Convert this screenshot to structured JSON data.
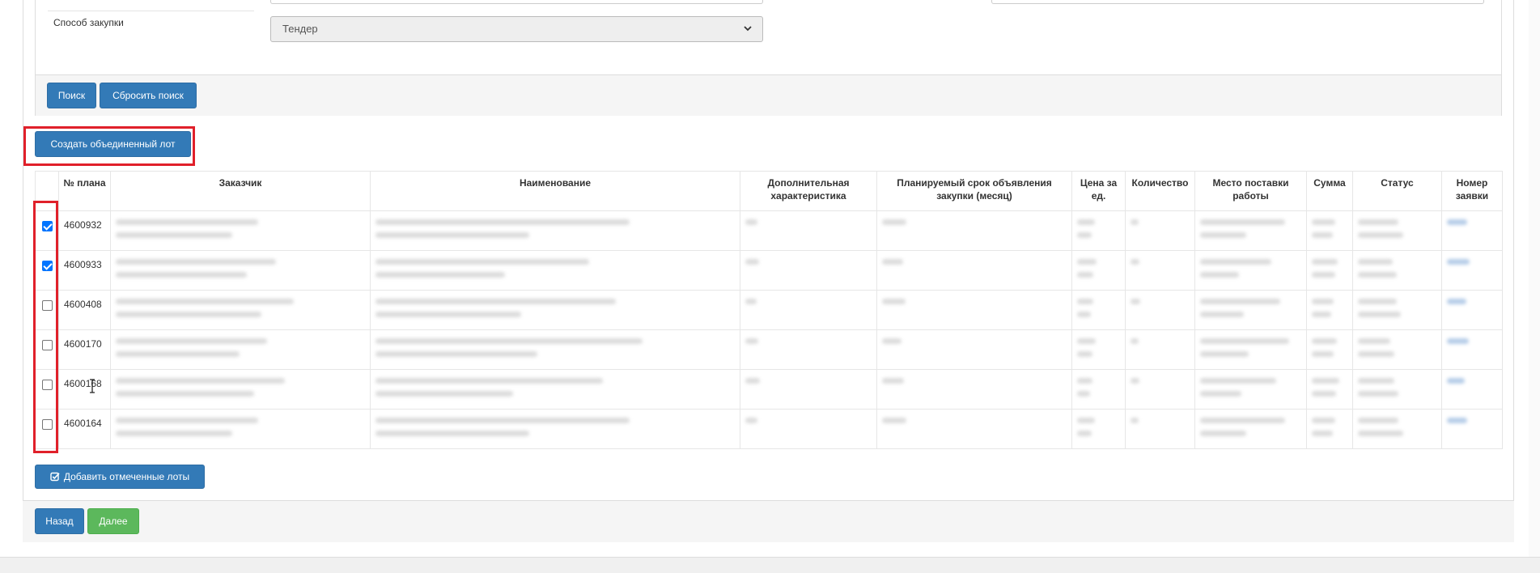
{
  "search": {
    "procurement_method_label": "Способ закупки",
    "procurement_method_value": "Тендер",
    "search_button": "Поиск",
    "reset_button": "Сбросить поиск"
  },
  "actions": {
    "create_merged_lot": "Создать объединенный лот",
    "add_checked_lots": "Добавить отмеченные лоты",
    "back": "Назад",
    "next": "Далее"
  },
  "table": {
    "columns": [
      "№ плана",
      "Заказчик",
      "Наименование",
      "Дополнительная характеристика",
      "Планируемый срок объявления закупки (месяц)",
      "Цена за ед.",
      "Количество",
      "Место поставки работы",
      "Сумма",
      "Статус",
      "Номер заявки"
    ],
    "rows": [
      {
        "plan": "4600932",
        "checked": true
      },
      {
        "plan": "4600933",
        "checked": true
      },
      {
        "plan": "4600408",
        "checked": false
      },
      {
        "plan": "4600170",
        "checked": false
      },
      {
        "plan": "4600168",
        "checked": false
      },
      {
        "plan": "4600164",
        "checked": false
      }
    ]
  },
  "colors": {
    "primary": "#337ab7",
    "success": "#5cb85c",
    "highlight": "#e0202a",
    "checkbox_checked": "#0075ff"
  },
  "icons": {
    "select_arrow": "chevron-down-icon",
    "add_button_icon": "checkbox-checked-icon"
  }
}
